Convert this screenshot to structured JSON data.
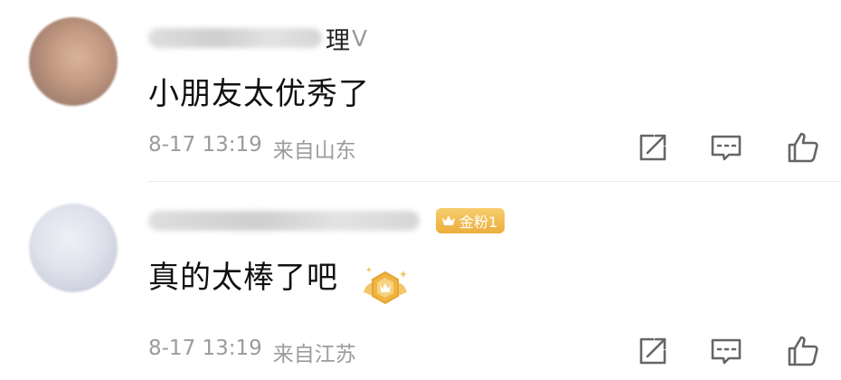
{
  "comments": [
    {
      "username_visible": "理",
      "username_extra": "V",
      "content": "小朋友太优秀了",
      "time": "8-17 13:19",
      "location": "来自山东"
    },
    {
      "username_visible": "",
      "username_extra": "",
      "badge": "金粉1",
      "content": "真的太棒了吧",
      "time": "8-17 13:19",
      "location": "来自江苏"
    }
  ],
  "colors": {
    "badge_gold": "#ecae3c",
    "meta_gray": "#9b9b9b",
    "icon_gray": "#666666"
  },
  "icons": {
    "share": "share-icon",
    "reply": "comment-icon",
    "like": "thumbs-up-icon",
    "badge": "crown-icon",
    "medal": "medal-icon"
  }
}
